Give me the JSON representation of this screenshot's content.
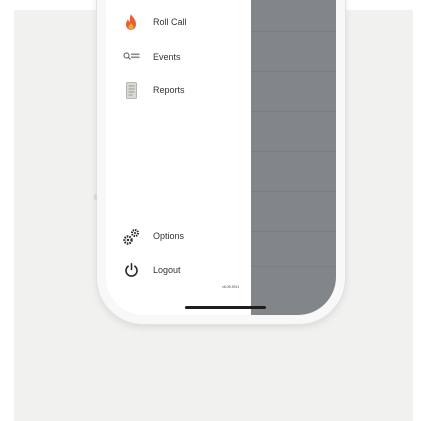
{
  "menu": {
    "items": [
      {
        "label": "Roll Call",
        "icon": "flame-icon",
        "icon_color": "#e8612c"
      },
      {
        "label": "Events",
        "icon": "search-list-icon"
      },
      {
        "label": "Reports",
        "icon": "document-icon"
      }
    ],
    "bottom_items": [
      {
        "label": "Options",
        "icon": "gears-icon"
      },
      {
        "label": "Logout",
        "icon": "power-icon"
      }
    ]
  },
  "version": "v6.05.3911",
  "colors": {
    "overlay": "#828689",
    "accent_flame": "#e8612c"
  }
}
